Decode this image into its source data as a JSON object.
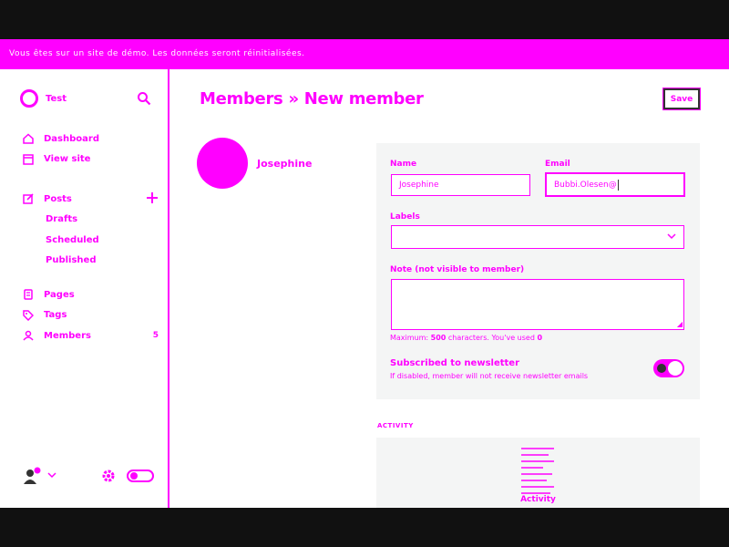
{
  "banner": {
    "text": "Vous êtes sur un site de démo. Les données seront réinitialisées."
  },
  "sidebar": {
    "brand": {
      "name": "Test"
    },
    "nav_top": [
      {
        "name": "nav-dashboard",
        "label": "Dashboard",
        "icon": "home-icon"
      },
      {
        "name": "nav-view-site",
        "label": "View site",
        "icon": "browser-icon"
      }
    ],
    "posts": {
      "label": "Posts",
      "icon": "edit-icon",
      "add_icon": "plus-icon"
    },
    "post_subitems": [
      {
        "label": "Drafts"
      },
      {
        "label": "Scheduled"
      },
      {
        "label": "Published"
      }
    ],
    "nav_bottom": [
      {
        "label": "Pages",
        "icon": "page-icon"
      },
      {
        "label": "Tags",
        "icon": "tag-icon"
      },
      {
        "label": "Members",
        "icon": "members-icon",
        "badge": "5"
      }
    ]
  },
  "header": {
    "breadcrumb_parent": "Members",
    "separator": "»",
    "breadcrumb_current": "New member",
    "save_label": "Save"
  },
  "member": {
    "display_name": "Josephine"
  },
  "form": {
    "name_label": "Name",
    "name_value": "Josephine",
    "email_label": "Email",
    "email_value": "Bubbi.Olesen@",
    "labels_label": "Labels",
    "note_label": "Note (not visible to member)",
    "note_hint_prefix": "Maximum: ",
    "note_hint_max": "500",
    "note_hint_mid": " characters. You've used ",
    "note_hint_used": "0",
    "newsletter_title": "Subscribed to newsletter",
    "newsletter_desc": "If disabled, member will not receive newsletter emails",
    "newsletter_on": true
  },
  "activity": {
    "heading": "ACTIVITY",
    "empty_label": "Activity"
  },
  "colors": {
    "accent": "#ff00ff",
    "frame": "#111111",
    "panel": "#f4f5f5"
  }
}
